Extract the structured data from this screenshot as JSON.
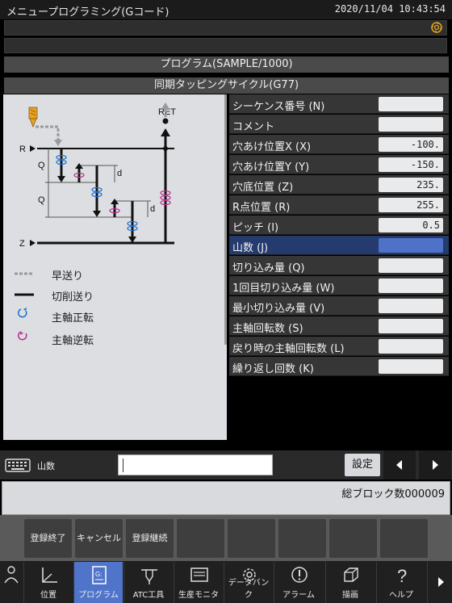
{
  "window": {
    "title": "メニュープログラミング(Gコード)",
    "datetime": "2020/11/04 10:43:54",
    "tool_icon": "tool-wheel-icon"
  },
  "program_header": "プログラム(SAMPLE/1000)",
  "cycle_header": "同期タッピングサイクル(G77)",
  "diagram": {
    "labels": {
      "ret": "RET",
      "r": "R",
      "z": "Z",
      "q1": "Q",
      "q2": "Q",
      "d1": "d",
      "d2": "d"
    },
    "legend": [
      {
        "icon": "rapid-feed-line-icon",
        "label": "早送り"
      },
      {
        "icon": "cutting-feed-line-icon",
        "label": "切削送り"
      },
      {
        "icon": "spindle-forward-icon",
        "label": "主軸正転"
      },
      {
        "icon": "spindle-reverse-icon",
        "label": "主軸逆転"
      }
    ],
    "colors": {
      "forward": "#1a6fd0",
      "reverse": "#b8308f"
    }
  },
  "params": [
    {
      "label": "シーケンス番号 (N)",
      "value": ""
    },
    {
      "label": "コメント",
      "value": ""
    },
    {
      "label": "穴あけ位置X (X)",
      "value": "-100."
    },
    {
      "label": "穴あけ位置Y (Y)",
      "value": "-150."
    },
    {
      "label": "穴底位置 (Z)",
      "value": "235."
    },
    {
      "label": "R点位置 (R)",
      "value": "255."
    },
    {
      "label": "ピッチ (I)",
      "value": "0.5"
    },
    {
      "label": "山数 (J)",
      "value": "",
      "selected": true
    },
    {
      "label": "切り込み量 (Q)",
      "value": ""
    },
    {
      "label": "1回目切り込み量 (W)",
      "value": ""
    },
    {
      "label": "最小切り込み量 (V)",
      "value": ""
    },
    {
      "label": "主軸回転数 (S)",
      "value": ""
    },
    {
      "label": "戻り時の主軸回転数 (L)",
      "value": ""
    },
    {
      "label": "繰り返し回数 (K)",
      "value": ""
    }
  ],
  "input": {
    "label": "山数",
    "value": "",
    "set_label": "設定",
    "keyboard_icon": "keyboard-icon",
    "prev_icon": "arrow-left-icon",
    "next_icon": "arrow-right-icon"
  },
  "message": {
    "total_blocks": "総ブロック数000009"
  },
  "softkeys": [
    "登録終了",
    "キャンセル",
    "登録継続",
    "",
    "",
    "",
    "",
    "",
    ""
  ],
  "nav": [
    {
      "label": "位置",
      "icon": "axes-icon"
    },
    {
      "label": "プログラム",
      "icon": "program-file-icon",
      "active": true
    },
    {
      "label": "ATC工具",
      "icon": "atc-tool-icon"
    },
    {
      "label": "生産モニタ",
      "icon": "monitor-icon"
    },
    {
      "label": "データバンク",
      "icon": "gear-icon"
    },
    {
      "label": "アラーム",
      "icon": "alarm-icon"
    },
    {
      "label": "描画",
      "icon": "cube-icon"
    },
    {
      "label": "ヘルプ",
      "icon": "help-icon"
    }
  ]
}
